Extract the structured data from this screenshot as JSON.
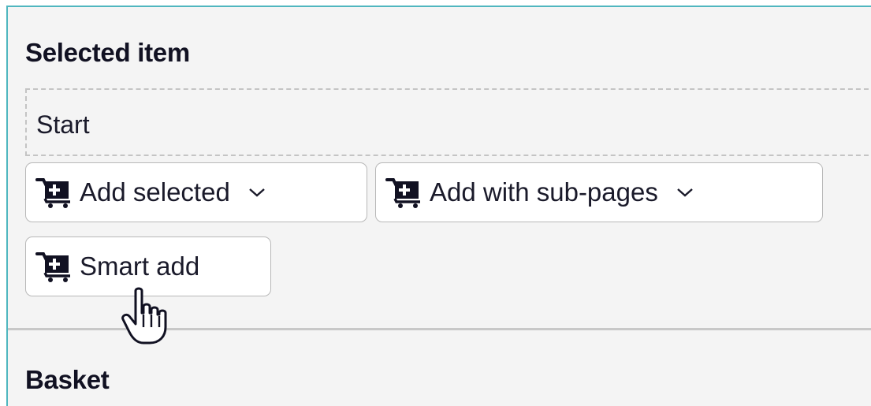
{
  "selected_section": {
    "title": "Selected item",
    "value": "Start"
  },
  "buttons": {
    "add_selected": "Add selected",
    "add_with_subpages": "Add with sub-pages",
    "smart_add": "Smart add"
  },
  "basket_section": {
    "title": "Basket"
  },
  "icons": {
    "cart": "cart-plus-icon",
    "dropdown": "chevron-down-icon",
    "cursor": "hand-pointer-icon"
  },
  "colors": {
    "accent_border": "#4fb6bf",
    "panel_bg": "#f4f4f4"
  }
}
